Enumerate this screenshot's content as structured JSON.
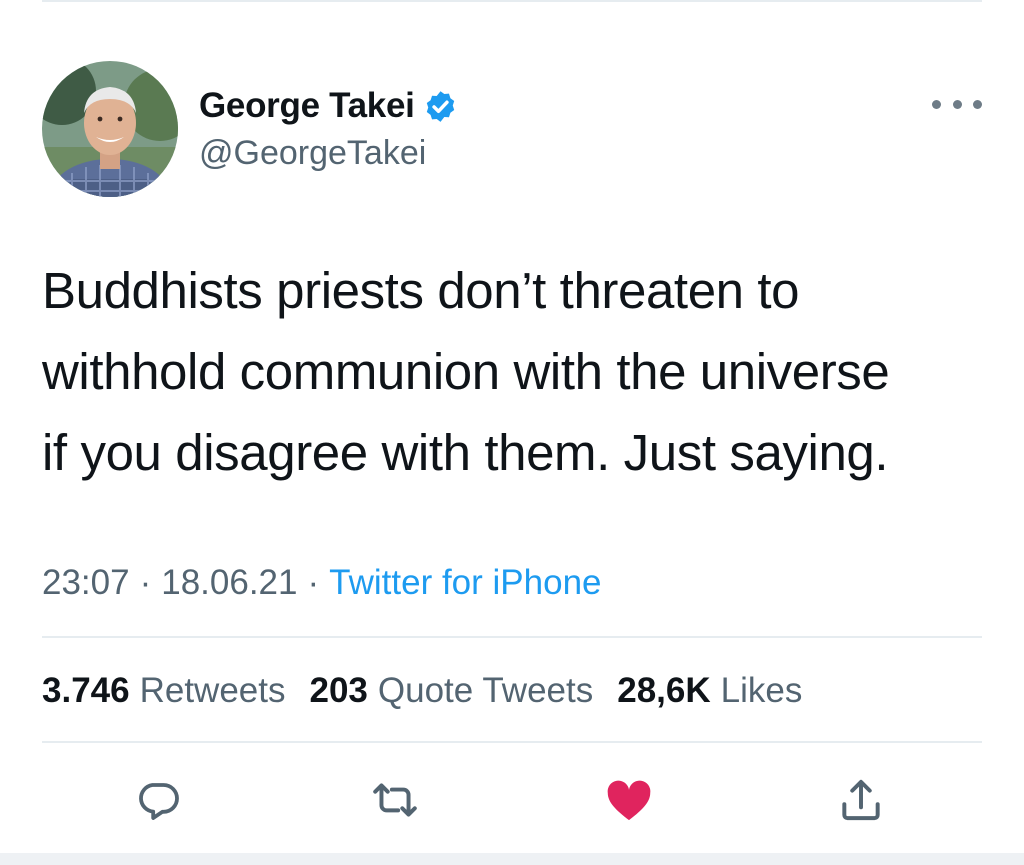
{
  "author": {
    "display_name": "George Takei",
    "handle": "@GeorgeTakei",
    "verified": true
  },
  "tweet": {
    "text_lines": [
      "Buddhists priests don’t threaten to",
      "withhold communion with the universe",
      "if you disagree with them. Just saying."
    ],
    "time": "23:07",
    "date": "18.06.21",
    "separator": "·",
    "source": "Twitter for iPhone"
  },
  "stats": {
    "retweets": {
      "count": "3.746",
      "label": "Retweets"
    },
    "quote_tweets": {
      "count": "203",
      "label": "Quote Tweets"
    },
    "likes": {
      "count": "28,6K",
      "label": "Likes"
    }
  },
  "actions": [
    "reply-icon",
    "retweet-icon",
    "like-icon",
    "share-icon"
  ],
  "state": {
    "liked": true
  },
  "colors": {
    "accent": "#1d9bf0",
    "verified": "#1d9bf0",
    "like": "#e0245e",
    "secondary_text": "#536471",
    "icon_gray": "#536471",
    "divider": "#e6ecf0"
  }
}
